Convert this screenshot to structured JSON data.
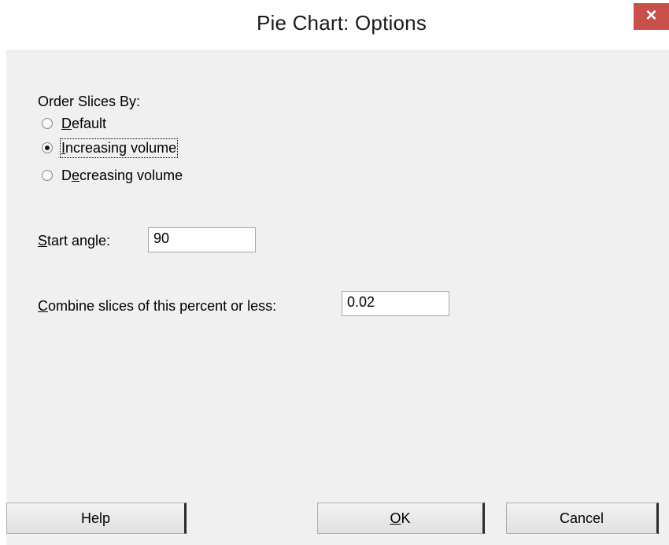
{
  "window": {
    "title": "Pie Chart: Options",
    "close_symbol": "×"
  },
  "order_slices": {
    "label": "Order Slices By:",
    "options": [
      {
        "mnemonic": "D",
        "rest": "efault",
        "selected": false
      },
      {
        "mnemonic": "I",
        "rest": "ncreasing volume",
        "selected": true
      },
      {
        "prefix": "D",
        "mnemonic": "e",
        "rest": "creasing volume",
        "selected": false
      }
    ]
  },
  "start_angle": {
    "mnemonic": "S",
    "label_rest": "tart angle:",
    "value": "90"
  },
  "combine_slices": {
    "mnemonic": "C",
    "label_rest": "ombine slices of this percent or less:",
    "value": "0.02"
  },
  "buttons": {
    "help": "Help",
    "ok_mnemonic": "O",
    "ok_rest": "K",
    "cancel": "Cancel"
  },
  "icons": {
    "close": "close-icon"
  }
}
